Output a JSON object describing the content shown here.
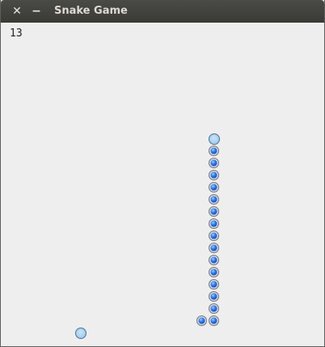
{
  "window": {
    "title": "Snake Game",
    "close_glyph": "✕",
    "minimize_glyph": "−"
  },
  "game": {
    "score": "13",
    "grid_size": 15,
    "head": [
      17,
      9
    ],
    "body": [
      [
        17,
        10
      ],
      [
        17,
        11
      ],
      [
        17,
        12
      ],
      [
        17,
        13
      ],
      [
        17,
        14
      ],
      [
        17,
        15
      ],
      [
        17,
        16
      ],
      [
        17,
        17
      ],
      [
        17,
        18
      ],
      [
        17,
        19
      ],
      [
        17,
        20
      ],
      [
        17,
        21
      ],
      [
        17,
        22
      ],
      [
        17,
        23
      ],
      [
        17,
        24
      ],
      [
        16,
        24
      ]
    ],
    "food": [
      6,
      25
    ],
    "colors": {
      "background": "#eeeeee",
      "body": "#0b49c9",
      "head": "#a9d2f2",
      "food": "#a9d2f2"
    }
  }
}
